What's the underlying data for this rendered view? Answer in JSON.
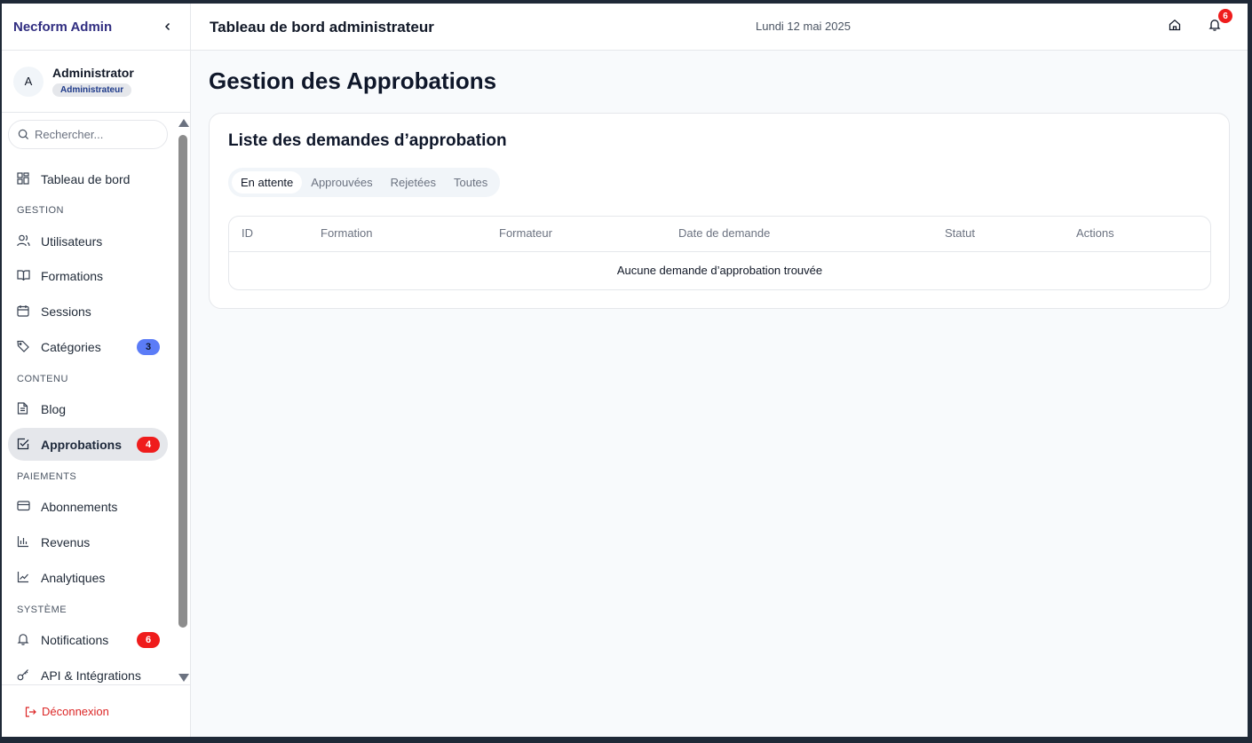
{
  "sidebar": {
    "brand": "Necform Admin",
    "user": {
      "initial": "A",
      "name": "Administrator",
      "role": "Administrateur"
    },
    "search_placeholder": "Rechercher...",
    "sections": {
      "gestion": "GESTION",
      "contenu": "CONTENU",
      "paiements": "PAIEMENTS",
      "systeme": "SYSTÈME"
    },
    "items": {
      "dashboard": "Tableau de bord",
      "users": "Utilisateurs",
      "formations": "Formations",
      "sessions": "Sessions",
      "categories": "Catégories",
      "categories_badge": "3",
      "blog": "Blog",
      "approbations": "Approbations",
      "approbations_badge": "4",
      "abonnements": "Abonnements",
      "revenus": "Revenus",
      "analytiques": "Analytiques",
      "notifications": "Notifications",
      "notifications_badge": "6",
      "api": "API & Intégrations"
    },
    "logout": "Déconnexion"
  },
  "header": {
    "title": "Tableau de bord administrateur",
    "date": "Lundi 12 mai 2025",
    "notification_count": "6"
  },
  "main": {
    "page_title": "Gestion des Approbations",
    "card_title": "Liste des demandes d’approbation",
    "tabs": [
      "En attente",
      "Approuvées",
      "Rejetées",
      "Toutes"
    ],
    "columns": [
      "ID",
      "Formation",
      "Formateur",
      "Date de demande",
      "Statut",
      "Actions"
    ],
    "empty_message": "Aucune demande d’approbation trouvée"
  }
}
